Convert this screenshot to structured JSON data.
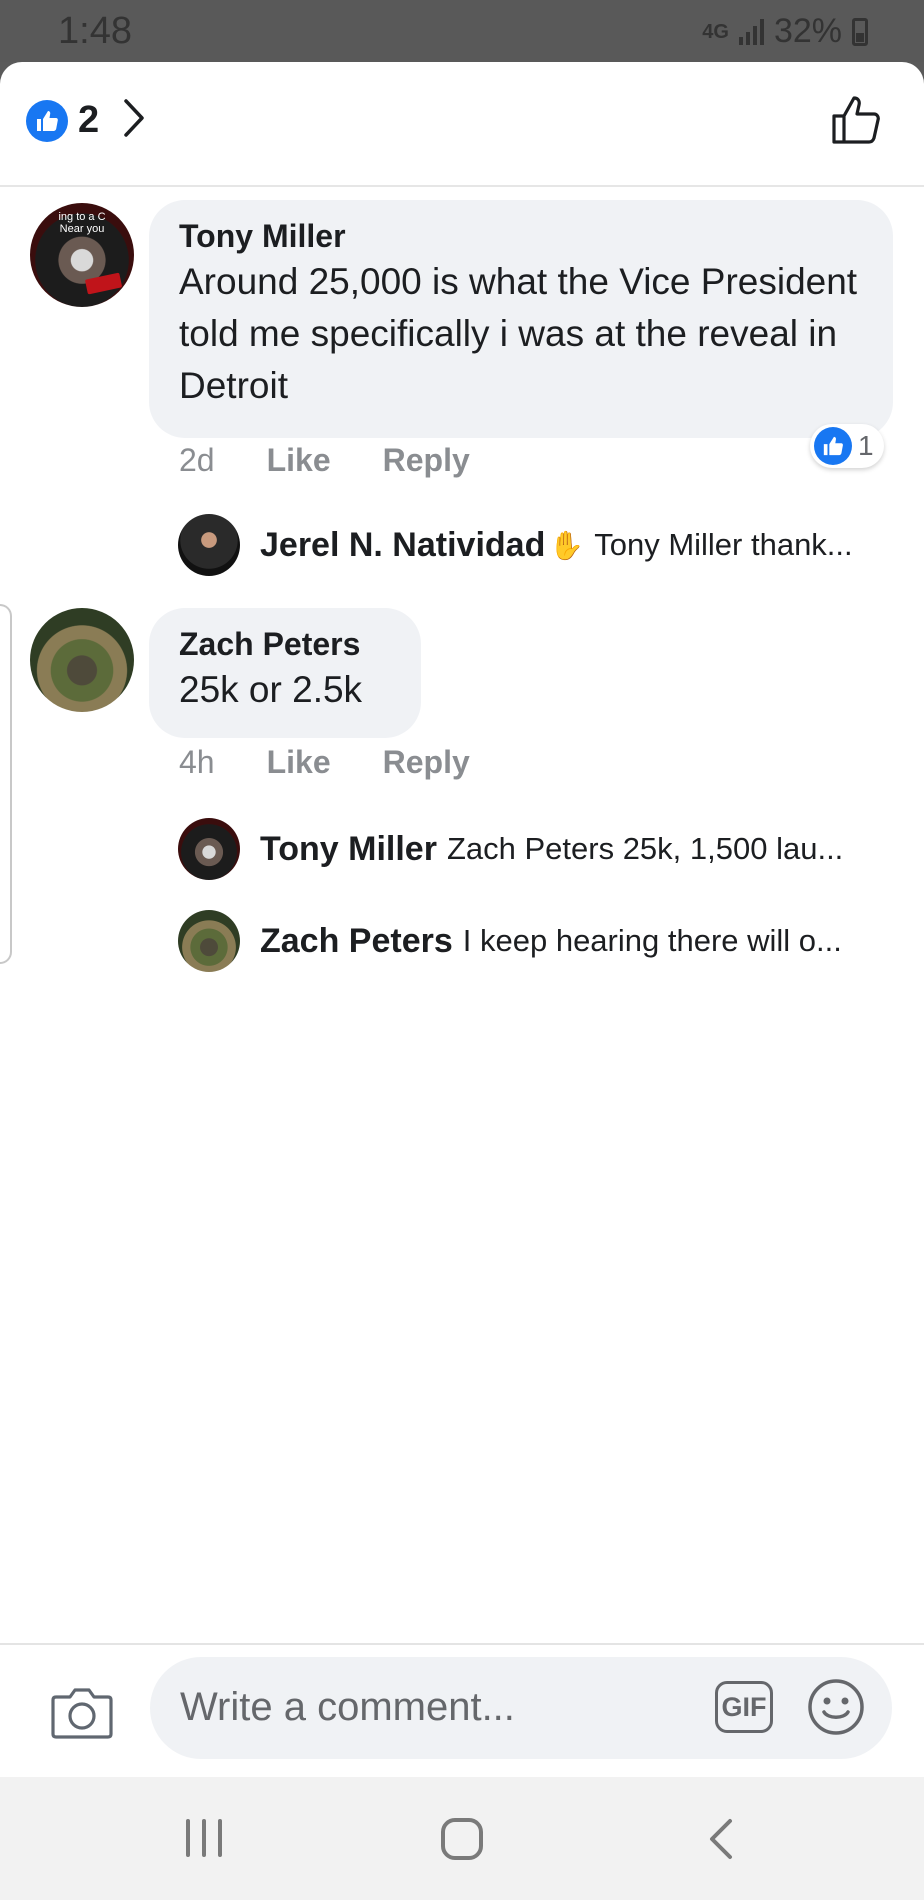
{
  "status_bar": {
    "time": "1:48",
    "network": "4G",
    "battery": "32%"
  },
  "header": {
    "reaction_count": "2"
  },
  "comments": [
    {
      "author": "Tony Miller",
      "avatar_text": "ing to a C\nNear you",
      "text": "Around 25,000 is what the Vice President told me specifically i was at the reveal in Detroit",
      "time": "2d",
      "like_label": "Like",
      "reply_label": "Reply",
      "reaction_count": "1",
      "replies": [
        {
          "author": "Jerel N. Natividad",
          "preview": "Tony Miller thank..."
        }
      ]
    },
    {
      "author": "Zach Peters",
      "text": "25k or 2.5k",
      "time": "4h",
      "like_label": "Like",
      "reply_label": "Reply",
      "replies": [
        {
          "author": "Tony Miller",
          "preview": "Zach Peters 25k, 1,500 lau..."
        },
        {
          "author": "Zach Peters",
          "preview": "I keep hearing there will o..."
        }
      ]
    }
  ],
  "composer": {
    "placeholder": "Write a comment...",
    "gif_label": "GIF"
  },
  "colors": {
    "facebook_blue": "#1877f2",
    "bubble_gray": "#f0f2f5",
    "meta_gray": "#8a8d91"
  },
  "icons": [
    "like-icon",
    "chevron-right-icon",
    "thumbs-up-outline-icon",
    "wave-icon",
    "camera-icon",
    "gif-icon",
    "emoji-icon",
    "recents-icon",
    "home-icon",
    "back-icon"
  ]
}
